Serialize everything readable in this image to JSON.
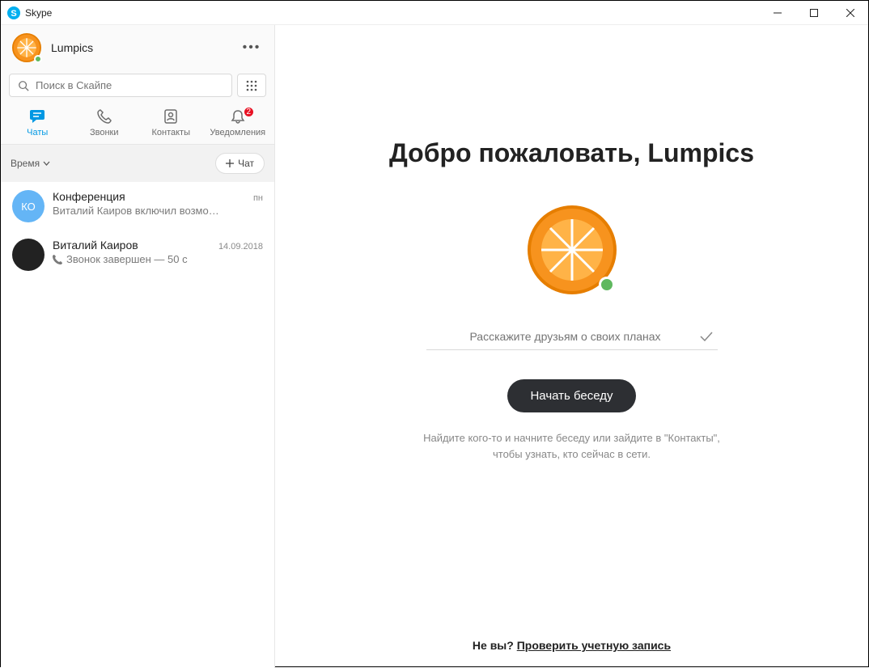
{
  "window": {
    "title": "Skype"
  },
  "profile": {
    "name": "Lumpics"
  },
  "search": {
    "placeholder": "Поиск в Скайпе"
  },
  "tabs": {
    "chats": "Чаты",
    "calls": "Звонки",
    "contacts": "Контакты",
    "notifications": "Уведомления",
    "notif_badge": "2"
  },
  "filter": {
    "label": "Время",
    "newchat": "Чат"
  },
  "chats": [
    {
      "avatar_text": "КО",
      "avatar_bg": "#64b5f6",
      "title": "Конференция",
      "time": "пн",
      "preview": "Виталий Каиров включил возмо…",
      "icon": "none"
    },
    {
      "avatar_text": "",
      "avatar_bg": "#222222",
      "title": "Виталий Каиров",
      "time": "14.09.2018",
      "preview": "Звонок завершен — 50 с",
      "icon": "call"
    }
  ],
  "main": {
    "welcome": "Добро пожаловать, Lumpics",
    "status_placeholder": "Расскажите друзьям о своих планах",
    "start_button": "Начать беседу",
    "hint": "Найдите кого-то и начните беседу или зайдите в \"Контакты\", чтобы узнать, кто сейчас в сети.",
    "notyou_prefix": "Не вы? ",
    "notyou_link": "Проверить учетную запись"
  }
}
